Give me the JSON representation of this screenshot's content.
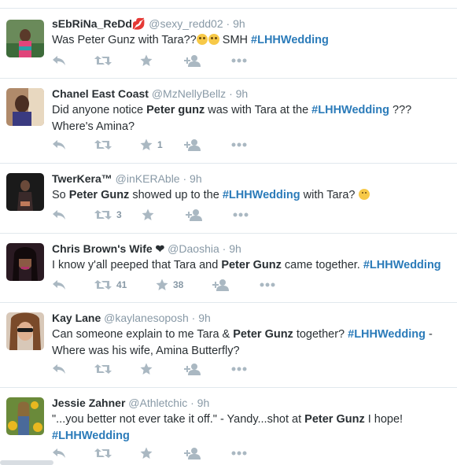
{
  "tweets": [
    {
      "fullname": "sEbRiNa_ReDd💋",
      "handle": "@sexy_redd02",
      "time": "9h",
      "segments": [
        {
          "t": "Was Peter Gunz with Tara??",
          "s": "plain"
        },
        {
          "t": "😳😳",
          "s": "plain"
        },
        {
          "t": " SMH ",
          "s": "plain"
        },
        {
          "t": "#LHHWedding",
          "s": "hashtag"
        }
      ],
      "retweets": "",
      "favorites": ""
    },
    {
      "fullname": "Chanel East Coast",
      "handle": "@MzNellyBellz",
      "time": "9h",
      "segments": [
        {
          "t": "Did anyone notice ",
          "s": "plain"
        },
        {
          "t": "Peter gunz",
          "s": "bold"
        },
        {
          "t": " was with Tara at the ",
          "s": "plain"
        },
        {
          "t": "#LHHWedding",
          "s": "hashtag"
        },
        {
          "t": " ??? Where's Amina?",
          "s": "plain"
        }
      ],
      "retweets": "",
      "favorites": "1"
    },
    {
      "fullname": "TwerKera™",
      "handle": "@inKERAble",
      "time": "9h",
      "segments": [
        {
          "t": "So ",
          "s": "plain"
        },
        {
          "t": "Peter Gunz",
          "s": "bold"
        },
        {
          "t": " showed up to the ",
          "s": "plain"
        },
        {
          "t": "#LHHWedding",
          "s": "hashtag"
        },
        {
          "t": " with Tara? ",
          "s": "plain"
        },
        {
          "t": "😕",
          "s": "plain"
        }
      ],
      "retweets": "3",
      "favorites": ""
    },
    {
      "fullname": "Chris Brown's Wife ❤",
      "handle": "@Daoshia",
      "time": "9h",
      "segments": [
        {
          "t": "I know y'all peeped that Tara and ",
          "s": "plain"
        },
        {
          "t": "Peter Gunz",
          "s": "bold"
        },
        {
          "t": " came together. ",
          "s": "plain"
        },
        {
          "t": "#LHHWedding",
          "s": "hashtag"
        }
      ],
      "retweets": "41",
      "favorites": "38"
    },
    {
      "fullname": "Kay Lane",
      "handle": "@kaylanesoposh",
      "time": "9h",
      "segments": [
        {
          "t": "Can someone explain to me Tara & ",
          "s": "plain"
        },
        {
          "t": "Peter Gunz",
          "s": "bold"
        },
        {
          "t": " together? ",
          "s": "plain"
        },
        {
          "t": "#LHHWedding",
          "s": "hashtag"
        },
        {
          "t": " - Where was his wife, Amina Butterfly?",
          "s": "plain"
        }
      ],
      "retweets": "",
      "favorites": ""
    },
    {
      "fullname": "Jessie Zahner",
      "handle": "@Athletchic",
      "time": "9h",
      "segments": [
        {
          "t": "\"...you better not ever take it off.\" - Yandy...shot at ",
          "s": "plain"
        },
        {
          "t": "Peter Gunz",
          "s": "bold"
        },
        {
          "t": " I hope! ",
          "s": "plain"
        },
        {
          "t": "#LHHWedding",
          "s": "hashtag"
        }
      ],
      "retweets": "",
      "favorites": ""
    }
  ],
  "colors": {
    "link": "#2b7bb9",
    "muted": "#8899a6",
    "icon": "#aab8c2",
    "text": "#292f33"
  }
}
